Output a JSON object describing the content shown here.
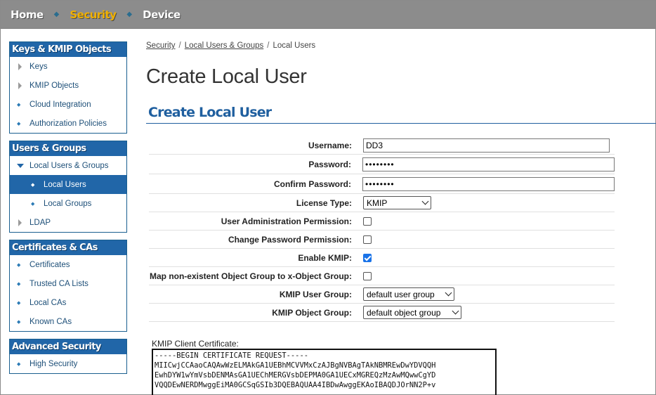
{
  "topnav": {
    "items": [
      {
        "label": "Home",
        "active": false
      },
      {
        "label": "Security",
        "active": true
      },
      {
        "label": "Device",
        "active": false
      }
    ],
    "colors": {
      "bar": "#8c8c8c",
      "active": "#f0b000"
    }
  },
  "sidebar": {
    "sections": [
      {
        "title": "Keys & KMIP Objects",
        "items": [
          {
            "label": "Keys",
            "icon": "triangle-right-icon"
          },
          {
            "label": "KMIP Objects",
            "icon": "triangle-right-icon"
          },
          {
            "label": "Cloud Integration",
            "icon": "bullet-icon"
          },
          {
            "label": "Authorization Policies",
            "icon": "bullet-icon"
          }
        ]
      },
      {
        "title": "Users & Groups",
        "items": [
          {
            "label": "Local Users & Groups",
            "icon": "triangle-down-icon"
          },
          {
            "label": "Local Users",
            "icon": "bullet-icon",
            "selected": true
          },
          {
            "label": "Local Groups",
            "icon": "bullet-icon"
          },
          {
            "label": "LDAP",
            "icon": "triangle-right-icon"
          }
        ]
      },
      {
        "title": "Certificates & CAs",
        "items": [
          {
            "label": "Certificates",
            "icon": "bullet-icon"
          },
          {
            "label": "Trusted CA Lists",
            "icon": "bullet-icon"
          },
          {
            "label": "Local CAs",
            "icon": "bullet-icon"
          },
          {
            "label": "Known CAs",
            "icon": "bullet-icon"
          }
        ]
      },
      {
        "title": "Advanced Security",
        "items": [
          {
            "label": "High Security",
            "icon": "bullet-icon"
          }
        ]
      }
    ],
    "colors": {
      "header": "#2166a8",
      "link": "#1d4f78"
    }
  },
  "breadcrumb": {
    "items": [
      "Security",
      "Local Users & Groups",
      "Local Users"
    ],
    "separator": "/"
  },
  "page_title": "Create Local User",
  "section_title": "Create Local User",
  "form": {
    "username": {
      "label": "Username:",
      "value": "DD3"
    },
    "password": {
      "label": "Password:",
      "value": "••••••••"
    },
    "confirm_password": {
      "label": "Confirm Password:",
      "value": "••••••••"
    },
    "license_type": {
      "label": "License Type:",
      "value": "KMIP"
    },
    "user_admin_permission": {
      "label": "User Administration Permission:",
      "checked": false
    },
    "change_password_permission": {
      "label": "Change Password Permission:",
      "checked": false
    },
    "enable_kmip": {
      "label": "Enable KMIP:",
      "checked": true
    },
    "map_object_group": {
      "label": "Map non-existent Object Group to x-Object Group:",
      "checked": false
    },
    "kmip_user_group": {
      "label": "KMIP User Group:",
      "value": "default user group"
    },
    "kmip_object_group": {
      "label": "KMIP Object Group:",
      "value": "default object group"
    },
    "kmip_client_certificate": {
      "label": "KMIP Client Certificate:",
      "lines": [
        "-----BEGIN CERTIFICATE REQUEST-----",
        "MIICwjCCAaoCAQAwWzELMAkGA1UEBhMCVVMxCzAJBgNVBAgTAkNBMREwDwYDVQQH",
        "EwhDYW1wYmVsbDENMAsGA1UEChMERGVsbDEPMA0GA1UECxMGREQzMzAwMQwwCgYD",
        "VQQDEwNERDMwggEiMA0GCSqGSIb3DQEBAQUAA4IBDwAwggEKAoIBAQDJOrNN2P+v"
      ]
    }
  }
}
